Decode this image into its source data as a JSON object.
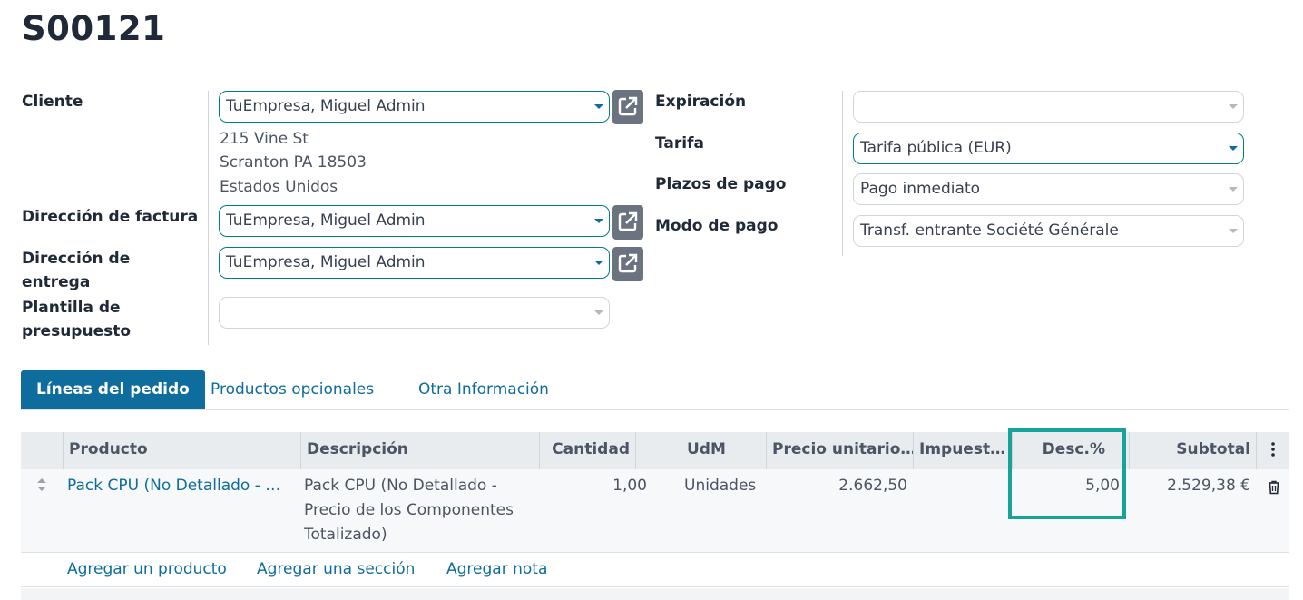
{
  "record": {
    "title": "S00121"
  },
  "form": {
    "left": {
      "customer_label": "Cliente",
      "customer_value": "TuEmpresa, Miguel Admin",
      "address_line1": "215 Vine St",
      "address_line2": "Scranton PA 18503",
      "address_line3": "Estados Unidos",
      "invoice_address_label": "Dirección de factura",
      "invoice_address_value": "TuEmpresa, Miguel Admin",
      "delivery_address_label_1": "Dirección de",
      "delivery_address_label_2": "entrega",
      "delivery_address_value": "TuEmpresa, Miguel Admin",
      "template_label_1": "Plantilla de",
      "template_label_2": "presupuesto",
      "template_value": ""
    },
    "right": {
      "expiration_label": "Expiración",
      "expiration_value": "",
      "pricelist_label": "Tarifa",
      "pricelist_value": "Tarifa pública (EUR)",
      "payment_terms_label": "Plazos de pago",
      "payment_terms_value": "Pago inmediato",
      "payment_mode_label": "Modo de pago",
      "payment_mode_value": "Transf. entrante Société Générale"
    }
  },
  "tabs": [
    {
      "label": "Líneas del pedido",
      "active": true
    },
    {
      "label": "Productos opcionales",
      "active": false
    },
    {
      "label": "Otra Información",
      "active": false
    }
  ],
  "order_lines": {
    "columns": {
      "product": "Producto",
      "description": "Descripción",
      "quantity": "Cantidad",
      "uom": "UdM",
      "unit_price": "Precio unitario…",
      "taxes": "Impuest…",
      "discount": "Desc.%",
      "subtotal": "Subtotal"
    },
    "rows": [
      {
        "product": "Pack CPU (No Detallado - …",
        "description_1": "Pack CPU (No Detallado -",
        "description_2": "Precio de los Componentes",
        "description_3": "Totalizado)",
        "quantity": "1,00",
        "uom": "Unidades",
        "unit_price": "2.662,50",
        "taxes": "",
        "discount": "5,00",
        "subtotal": "2.529,38 €"
      }
    ],
    "add_product": "Agregar un producto",
    "add_section": "Agregar una sección",
    "add_note": "Agregar nota"
  },
  "icons": {
    "external_link": "external-link-icon",
    "drag_handle": "sort-handle-icon",
    "delete": "trash-icon",
    "column_options": "kebab-menu-icon"
  },
  "colors": {
    "brand": "#0e6d9c",
    "active_field_border": "#017e84",
    "highlight": "#17a39a"
  }
}
